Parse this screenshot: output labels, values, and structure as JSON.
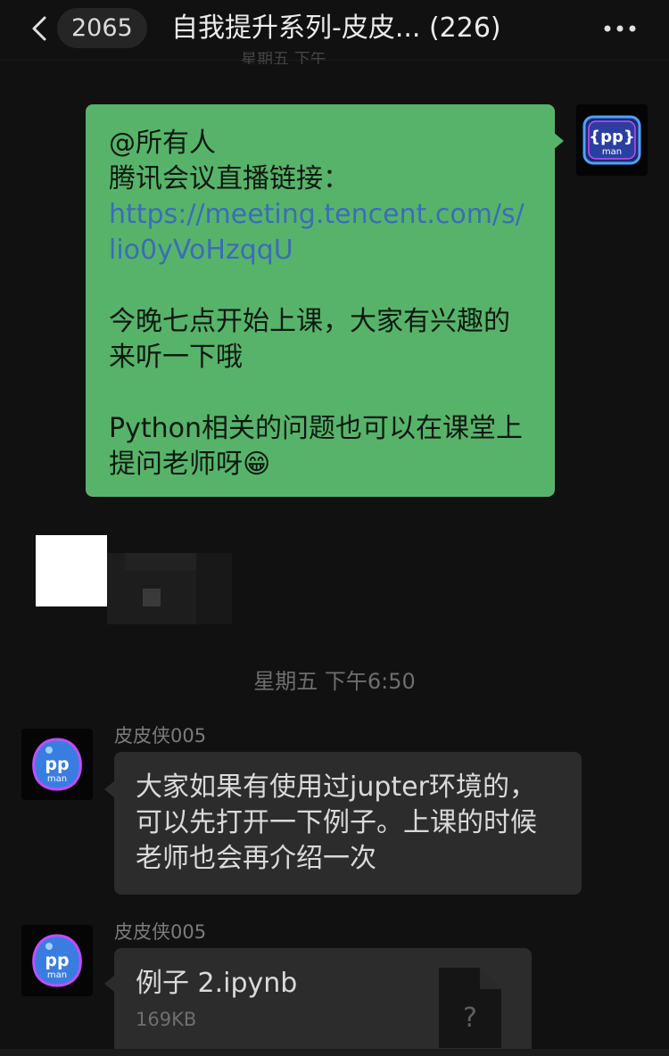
{
  "header": {
    "back_icon": "chevron-left-icon",
    "unread_count": "2065",
    "title": "自我提升系列-皮皮... (226)",
    "more_icon": "more-horizontal-icon",
    "peek_text": "星期五 下午"
  },
  "messages": [
    {
      "type": "text",
      "direction": "outgoing",
      "avatar": "ppman-logo-avatar",
      "line1": "@所有人",
      "line2": "腾讯会议直播链接：",
      "link": "https://meeting.tencent.com/s/lio0yVoHzqqU",
      "para2": "今晚七点开始上课，大家有兴趣的来听一下哦",
      "para3": "Python相关的问题也可以在课堂上提问老师呀😁"
    },
    {
      "type": "image",
      "direction": "outgoing",
      "blurred": true
    },
    {
      "type": "timestamp",
      "text": "星期五 下午6:50"
    },
    {
      "type": "text",
      "direction": "incoming",
      "sender": "皮皮侠005",
      "avatar": "ppman-logo-avatar",
      "text": "大家如果有使用过jupter环境的，可以先打开一下例子。上课的时候老师也会再介绍一次"
    },
    {
      "type": "file",
      "direction": "incoming",
      "sender": "皮皮侠005",
      "avatar": "ppman-logo-avatar",
      "file_name": "例子 2.ipynb",
      "file_size": "169KB",
      "file_icon": "unknown-file-icon",
      "file_icon_glyph": "?"
    }
  ],
  "colors": {
    "background": "#111111",
    "outgoing_bubble": "#58b36a",
    "incoming_bubble": "#2c2c2c",
    "link": "#3a6db8"
  }
}
